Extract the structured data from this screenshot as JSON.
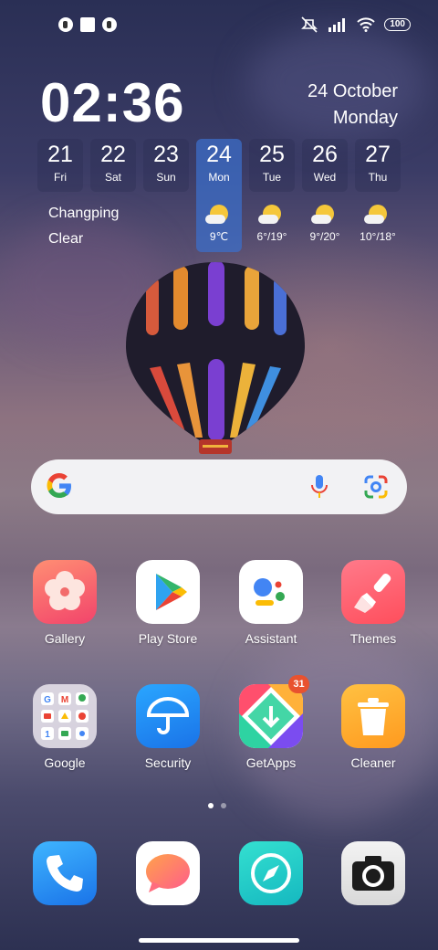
{
  "status_bar": {
    "left_icons": [
      "notification-icon",
      "square-notification-icon",
      "notification-icon"
    ],
    "right_icons": [
      "mute-icon",
      "signal-icon",
      "wifi-icon",
      "battery-icon"
    ],
    "battery": "100"
  },
  "clock": {
    "time": "02:36",
    "date": "24 October",
    "weekday": "Monday"
  },
  "weather": {
    "location": "Changping",
    "condition": "Clear",
    "days": [
      {
        "num": "21",
        "name": "Fri"
      },
      {
        "num": "22",
        "name": "Sat"
      },
      {
        "num": "23",
        "name": "Sun"
      },
      {
        "num": "24",
        "name": "Mon",
        "today": true,
        "temp": "9℃"
      },
      {
        "num": "25",
        "name": "Tue",
        "temp": "6°/19°"
      },
      {
        "num": "26",
        "name": "Wed",
        "temp": "9°/20°"
      },
      {
        "num": "27",
        "name": "Thu",
        "temp": "10°/18°"
      }
    ]
  },
  "search": {
    "icons": [
      "google-logo",
      "microphone-icon",
      "google-lens-icon"
    ]
  },
  "apps": [
    {
      "label": "Gallery",
      "icon": "gallery-icon"
    },
    {
      "label": "Play Store",
      "icon": "play-store-icon"
    },
    {
      "label": "Assistant",
      "icon": "assistant-icon"
    },
    {
      "label": "Themes",
      "icon": "themes-icon"
    },
    {
      "label": "Google",
      "icon": "google-folder-icon"
    },
    {
      "label": "Security",
      "icon": "security-icon"
    },
    {
      "label": "GetApps",
      "icon": "getapps-icon",
      "badge": "31"
    },
    {
      "label": "Cleaner",
      "icon": "cleaner-icon"
    }
  ],
  "dock": [
    {
      "icon": "phone-icon"
    },
    {
      "icon": "messages-icon"
    },
    {
      "icon": "browser-icon"
    },
    {
      "icon": "camera-icon"
    }
  ],
  "page_indicator": {
    "count": 2,
    "active": 1
  }
}
